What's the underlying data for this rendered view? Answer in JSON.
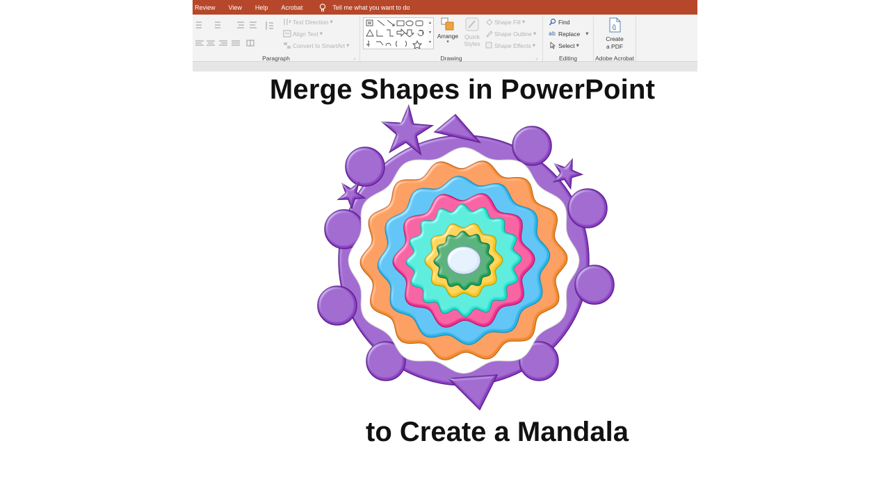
{
  "menubar": {
    "tabs": [
      "Review",
      "View",
      "Help",
      "Acrobat"
    ],
    "tell_me": "Tell me what you want to do"
  },
  "ribbon": {
    "paragraph": {
      "label": "Paragraph",
      "text_direction": "Text Direction",
      "align_text": "Align Text",
      "convert_smartart": "Convert to SmartArt"
    },
    "drawing": {
      "label": "Drawing",
      "arrange": "Arrange",
      "quick_styles_1": "Quick",
      "quick_styles_2": "Styles",
      "shape_fill": "Shape Fill",
      "shape_outline": "Shape Outline",
      "shape_effects": "Shape Effects"
    },
    "editing": {
      "label": "Editing",
      "find": "Find",
      "replace": "Replace",
      "select": "Select"
    },
    "acrobat": {
      "label": "Adobe Acrobat",
      "create_1": "Create",
      "create_2": "a PDF"
    }
  },
  "slide": {
    "title": "Merge Shapes in PowerPoint",
    "subtitle": "to Create a Mandala"
  },
  "colors": {
    "menubar": "#b7472a",
    "ring_purple": "#8b3fc1",
    "ring_orange": "#f08a2c",
    "ring_blue": "#2bb5ea",
    "ring_pink": "#ec2f8f",
    "ring_teal": "#1fe0cf",
    "ring_yellow": "#f4c61a",
    "ring_green": "#1aa05a",
    "center": "#d8e6f5"
  }
}
